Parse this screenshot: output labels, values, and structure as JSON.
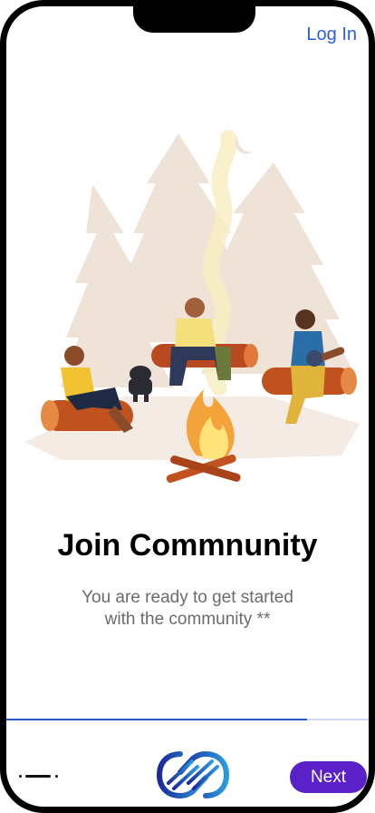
{
  "header": {
    "login_label": "Log In"
  },
  "onboarding": {
    "title": "Join Commnunity",
    "subtitle_line1": "You are ready to get started",
    "subtitle_line2": "with the community **"
  },
  "progress": {
    "fraction": 0.83
  },
  "footer": {
    "next_label": "Next"
  },
  "colors": {
    "accent": "#2a5fd9",
    "button": "#5a21c8",
    "progress": "#2b57c9",
    "tree": "#efe3d8"
  }
}
